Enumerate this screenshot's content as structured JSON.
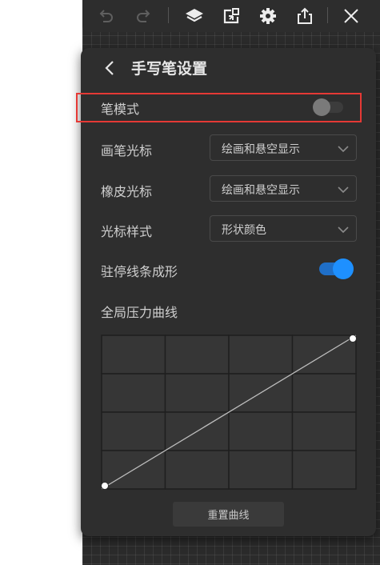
{
  "toolbar": {
    "icons": [
      "undo-icon",
      "redo-icon",
      "layers-icon",
      "import-icon",
      "settings-icon",
      "share-icon",
      "close-icon"
    ]
  },
  "panel": {
    "title": "手写笔设置",
    "pen_mode": {
      "label": "笔模式",
      "enabled": false
    },
    "brush_cursor": {
      "label": "画笔光标",
      "value": "绘画和悬空显示"
    },
    "eraser_cursor": {
      "label": "橡皮光标",
      "value": "绘画和悬空显示"
    },
    "cursor_style": {
      "label": "光标样式",
      "value": "形状颜色"
    },
    "stroke_shape": {
      "label": "驻停线条成形",
      "enabled": true
    },
    "pressure_curve": {
      "label": "全局压力曲线",
      "grid": {
        "columns": 4,
        "rows": 4
      },
      "points": [
        [
          0,
          0
        ],
        [
          1,
          1
        ]
      ]
    },
    "reset_label": "重置曲线"
  },
  "colors": {
    "panel_bg": "#2e2e2e",
    "accent": "#1e90ff",
    "highlight": "#e53935"
  }
}
